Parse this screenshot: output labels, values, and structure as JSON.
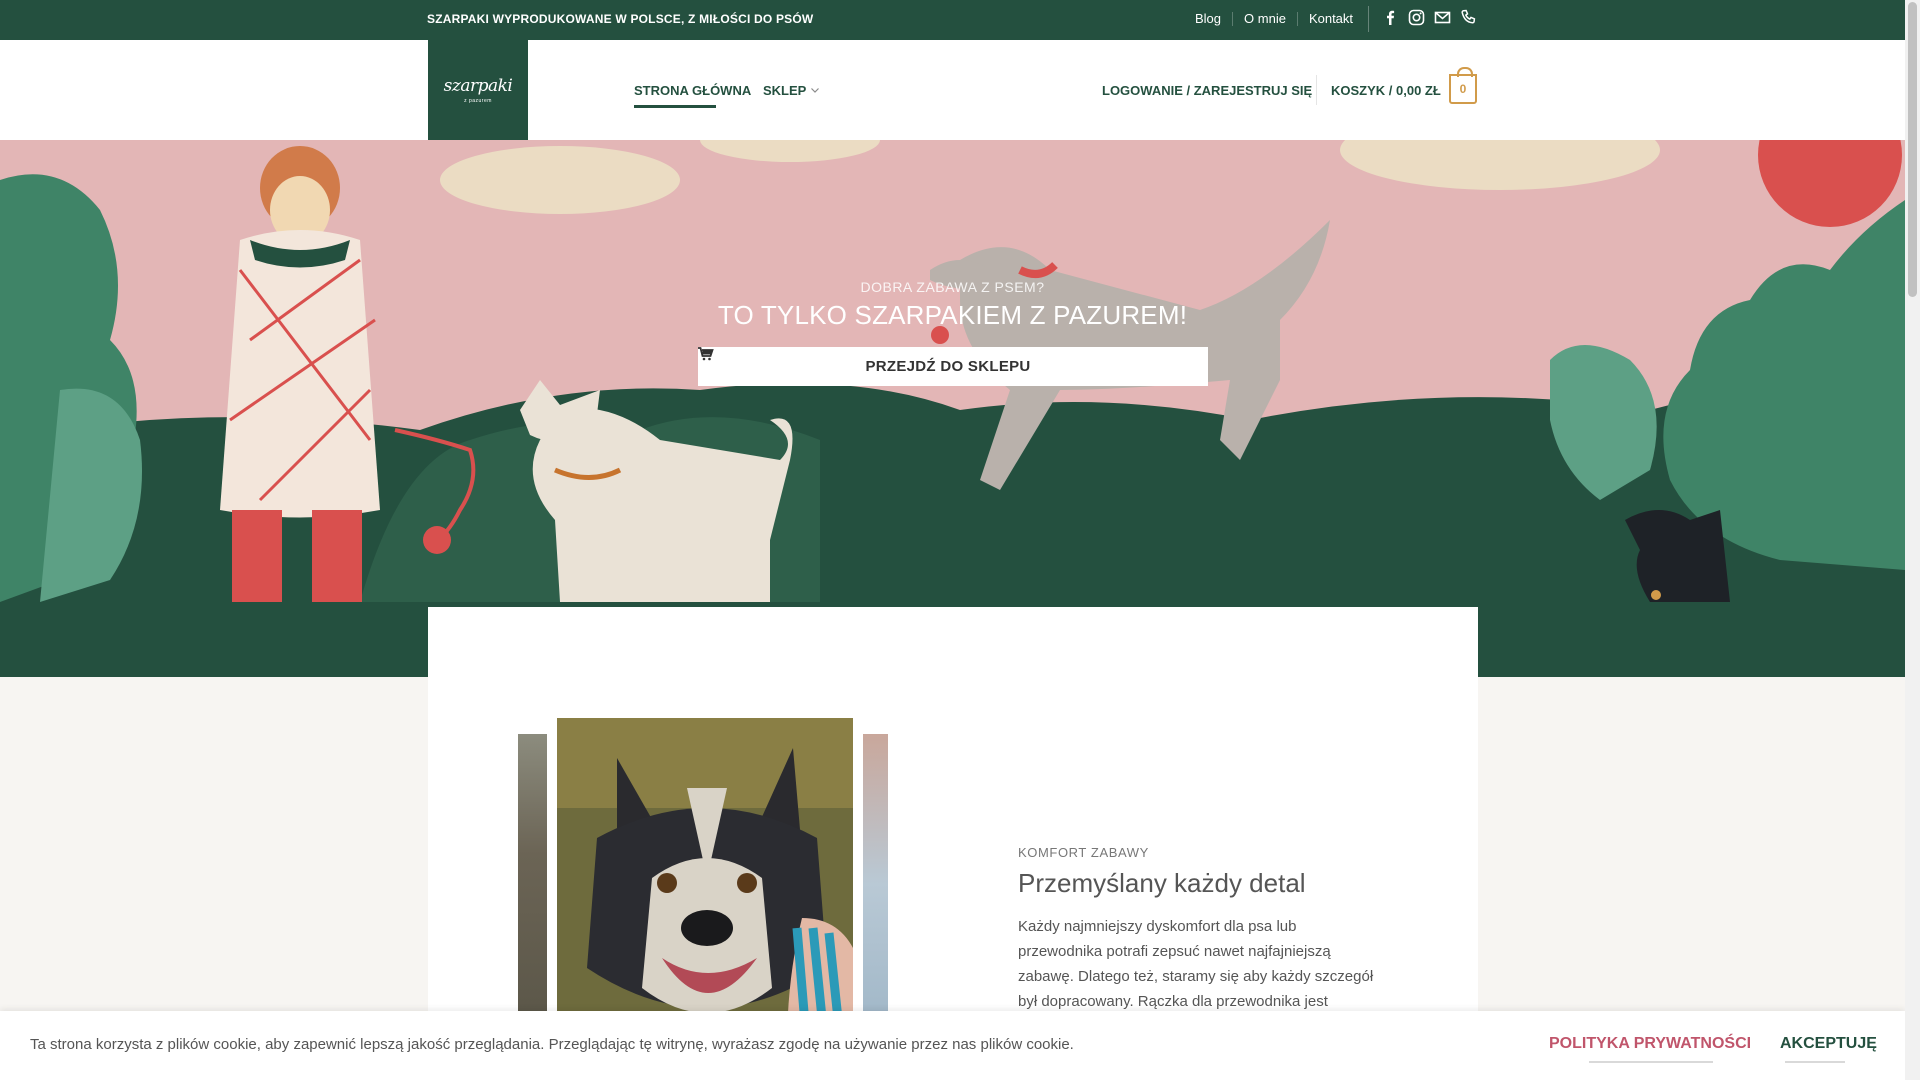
{
  "topbar": {
    "promo": "SZARPAKI WYPRODUKOWANE W POLSCE, Z MIŁOŚCI DO PSÓW",
    "links": [
      "Blog",
      "O mnie",
      "Kontakt"
    ],
    "social_icons": [
      "facebook-icon",
      "instagram-icon",
      "mail-icon",
      "phone-icon"
    ]
  },
  "header": {
    "logo_main": "szarpaki",
    "logo_sub": "z pazurem",
    "nav": {
      "home": "STRONA GŁÓWNA",
      "shop": "SKLEP"
    },
    "login": "LOGOWANIE / ZAREJESTRUJ SIĘ",
    "cart": "KOSZYK / 0,00 ZŁ",
    "cart_count": "0"
  },
  "hero": {
    "subtitle": "DOBRA ZABAWA Z PSEM?",
    "title": "TO TYLKO SZARPAKIEM Z PAZUREM!",
    "button": "PRZEJDŹ DO SKLEPU"
  },
  "feature": {
    "eyebrow": "KOMFORT ZABAWY",
    "headline": "Przemyślany każdy detal",
    "body": "Każdy najmniejszy dyskomfort dla psa lub przewodnika potrafi zepsuć nawet najfajniejszą zabawę. Dlatego też, staramy się aby każdy szczegół był dopracowany. Rączka dla przewodnika jest"
  },
  "cookie": {
    "text": "Ta strona korzysta z plików cookie, aby zapewnić lepszą jakość przeglądania. Przeglądając tę witrynę, wyrażasz zgodę na używanie przez nas plików cookie.",
    "policy": "POLITYKA PRYWATNOŚCI",
    "accept": "AKCEPTUJĘ"
  },
  "colors": {
    "brand_green": "#24503f",
    "hero_pink": "#e3b6b6",
    "cart_accent": "#d19b4a",
    "policy_red": "#c0556b"
  }
}
